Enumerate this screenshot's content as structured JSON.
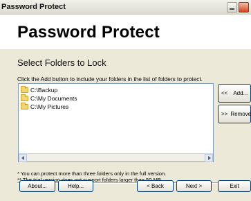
{
  "window": {
    "title": "Password Protect"
  },
  "header": {
    "heading": "Password Protect"
  },
  "page": {
    "subheading": "Select Folders to Lock",
    "instructions": "Click the Add button to include your folders in the list of folders to protect."
  },
  "folder_list": {
    "items": [
      {
        "label": "C:\\Backup",
        "icon": "folder-icon"
      },
      {
        "label": "C:\\My Documents",
        "icon": "folder-icon"
      },
      {
        "label": "C:\\My Pictures",
        "icon": "folder-icon"
      }
    ]
  },
  "side_buttons": {
    "add_prefix": "<<",
    "add_label": "Add...",
    "remove_prefix": ">>",
    "remove_label": "Remove"
  },
  "notes": {
    "note1": "*  You can protect more than three folders only in the full version.",
    "note2": "** The trial version does not support folders larger than 50 MB."
  },
  "footer": {
    "about_label": "About...",
    "help_label": "Help...",
    "back_label": "< Back",
    "next_label": "Next >",
    "exit_label": "Exit"
  },
  "colors": {
    "dialog_bg": "#ece9d8",
    "header_bg": "#ffffff",
    "button_border": "#003c74",
    "list_border": "#7f9db9",
    "close_button": "#d44420"
  }
}
